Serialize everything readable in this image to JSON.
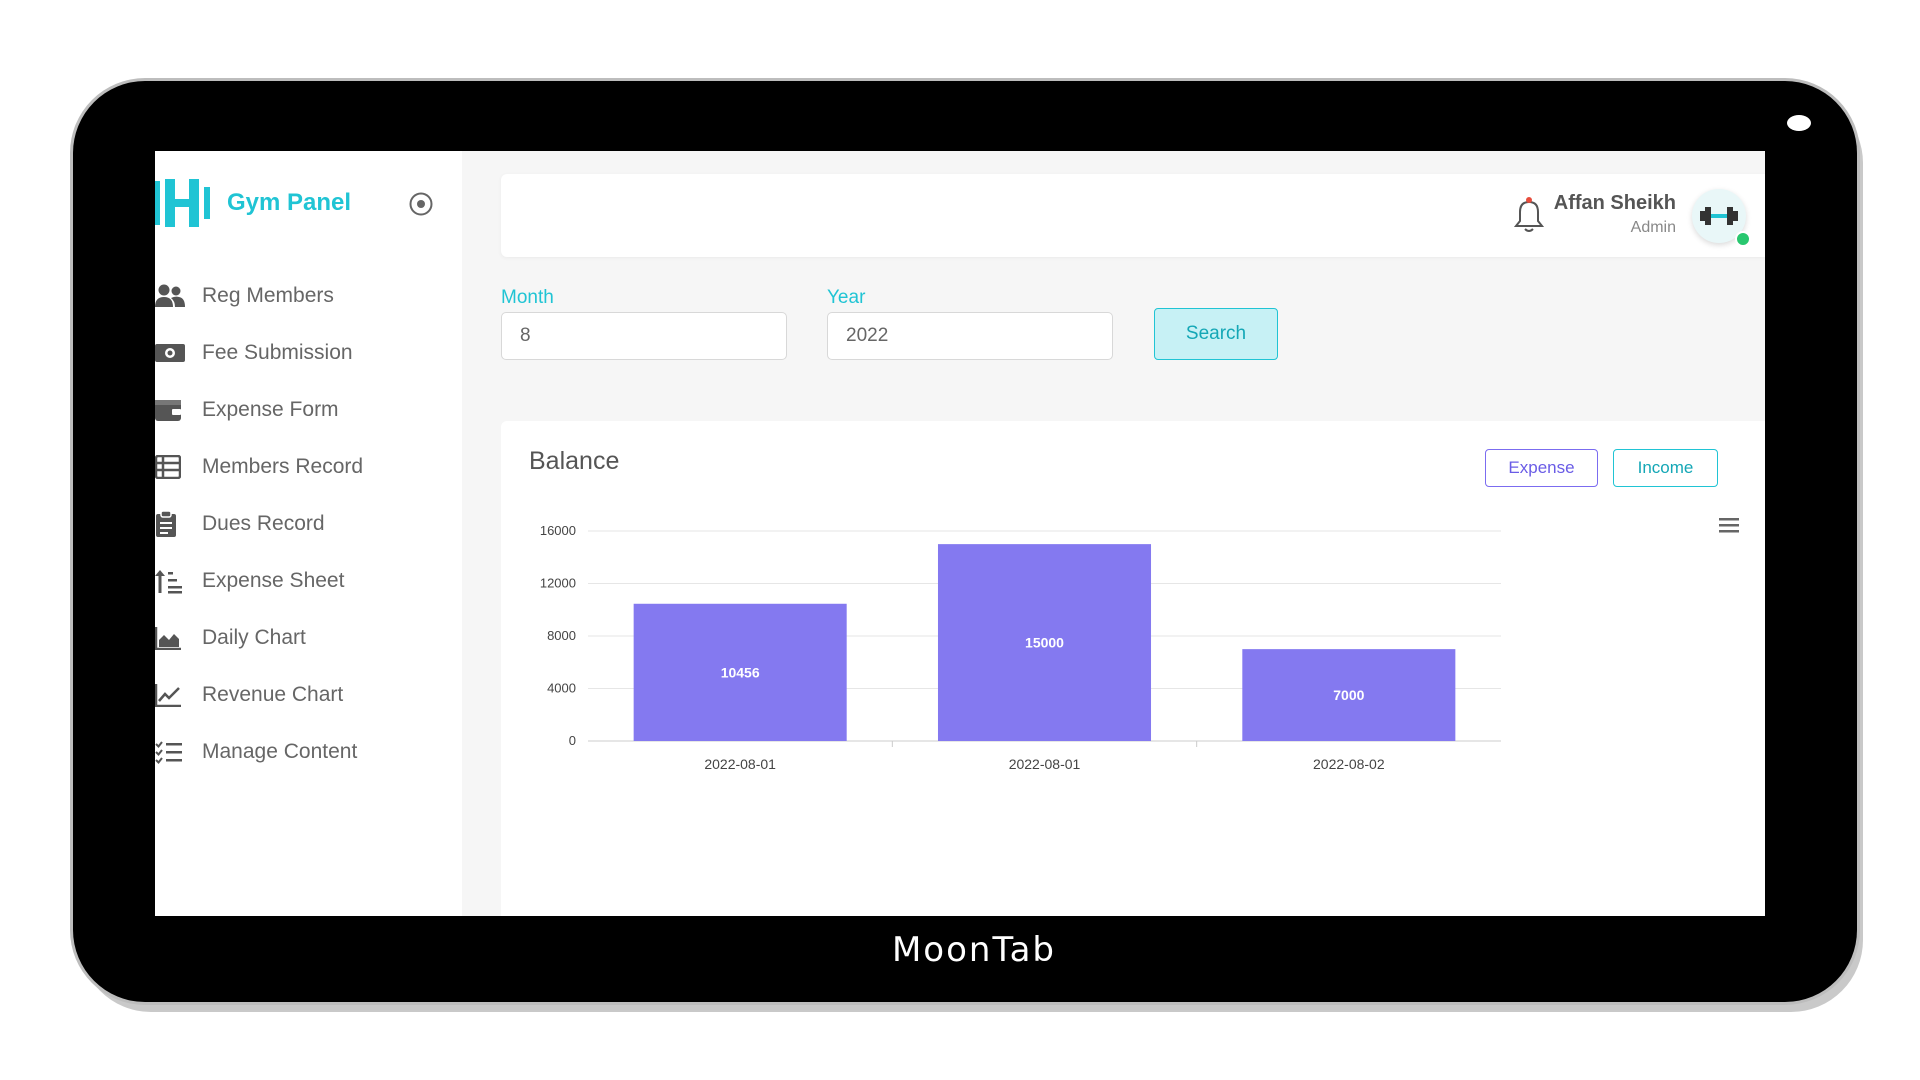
{
  "device": {
    "brand": "MoonTab"
  },
  "sidebar": {
    "logo_text": "Gym Panel",
    "items": [
      {
        "label": "Reg Members",
        "icon": "users-icon"
      },
      {
        "label": "Fee Submission",
        "icon": "money-icon"
      },
      {
        "label": "Expense Form",
        "icon": "wallet-icon"
      },
      {
        "label": "Members Record",
        "icon": "table-icon"
      },
      {
        "label": "Dues Record",
        "icon": "clipboard-icon"
      },
      {
        "label": "Expense Sheet",
        "icon": "sort-list-icon"
      },
      {
        "label": "Daily Chart",
        "icon": "area-chart-icon"
      },
      {
        "label": "Revenue Chart",
        "icon": "line-chart-icon"
      },
      {
        "label": "Manage Content",
        "icon": "checklist-icon"
      }
    ]
  },
  "header": {
    "user_name": "Affan Sheikh",
    "user_role": "Admin"
  },
  "filters": {
    "month_label": "Month",
    "month_value": "8",
    "year_label": "Year",
    "year_value": "2022",
    "search_label": "Search"
  },
  "card": {
    "title": "Balance",
    "expense_label": "Expense",
    "income_label": "Income"
  },
  "colors": {
    "accent": "#20c4d4",
    "bar": "#8479f0",
    "expense_border": "#7b6cf0"
  },
  "chart_data": {
    "type": "bar",
    "categories": [
      "2022-08-01",
      "2022-08-01",
      "2022-08-02"
    ],
    "values": [
      10456,
      15000,
      7000
    ],
    "yticks": [
      0,
      4000,
      8000,
      12000,
      16000
    ],
    "ylim": [
      0,
      16000
    ],
    "title": "",
    "xlabel": "",
    "ylabel": "",
    "grid": true
  }
}
